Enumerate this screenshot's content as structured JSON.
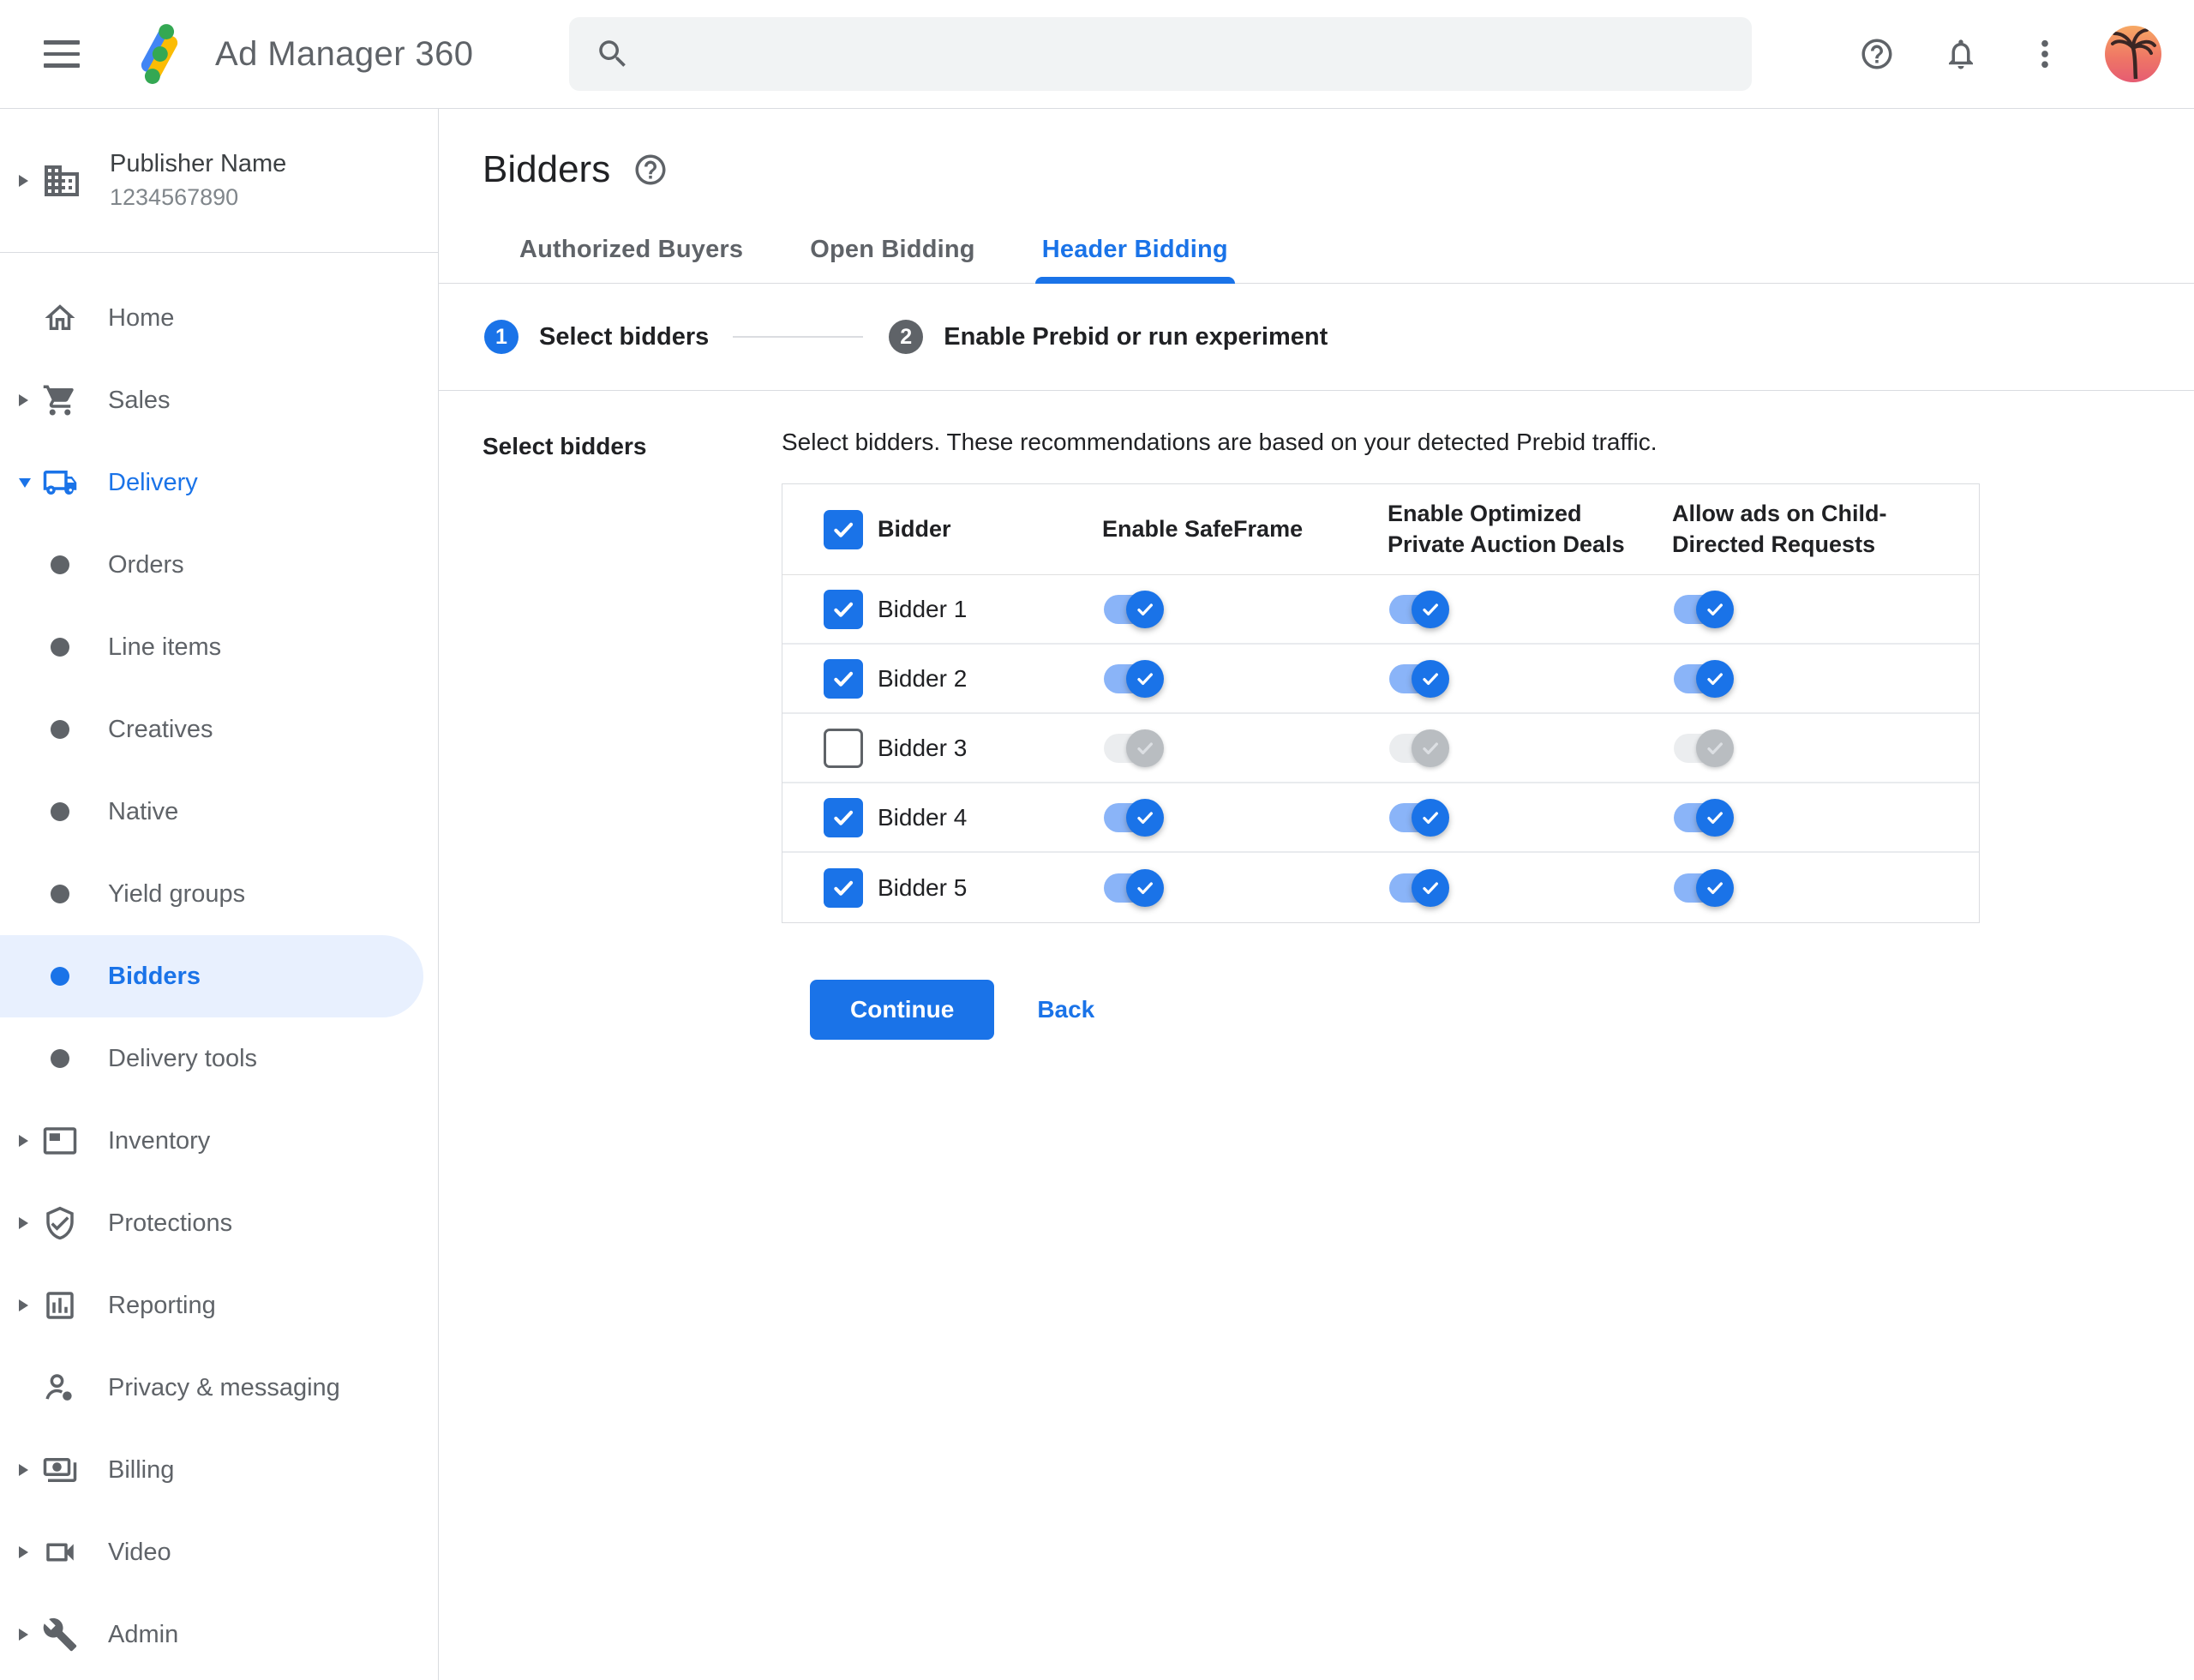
{
  "topbar": {
    "app_name": "Ad Manager 360",
    "search": {
      "value": "",
      "placeholder": ""
    },
    "icons": [
      "menu-icon",
      "ad-manager-logo",
      "search-icon",
      "help-icon",
      "notifications-icon",
      "more-options-icon",
      "account-avatar"
    ]
  },
  "sidebar": {
    "publisher": {
      "name": "Publisher Name",
      "account_id": "1234567890"
    },
    "items": [
      {
        "label": "Home",
        "level": "root",
        "expandable": false,
        "selected": false
      },
      {
        "label": "Sales",
        "level": "root",
        "expandable": true,
        "selected": false
      },
      {
        "label": "Delivery",
        "level": "root",
        "expandable": true,
        "expanded": true,
        "selected": false
      },
      {
        "label": "Orders",
        "level": "sub",
        "selected": false
      },
      {
        "label": "Line items",
        "level": "sub",
        "selected": false
      },
      {
        "label": "Creatives",
        "level": "sub",
        "selected": false
      },
      {
        "label": "Native",
        "level": "sub",
        "selected": false
      },
      {
        "label": "Yield groups",
        "level": "sub",
        "selected": false
      },
      {
        "label": "Bidders",
        "level": "sub",
        "selected": true
      },
      {
        "label": "Delivery tools",
        "level": "sub",
        "selected": false
      },
      {
        "label": "Inventory",
        "level": "root",
        "expandable": true,
        "selected": false
      },
      {
        "label": "Protections",
        "level": "root",
        "expandable": true,
        "selected": false
      },
      {
        "label": "Reporting",
        "level": "root",
        "expandable": true,
        "selected": false
      },
      {
        "label": "Privacy & messaging",
        "level": "root",
        "expandable": false,
        "selected": false
      },
      {
        "label": "Billing",
        "level": "root",
        "expandable": true,
        "selected": false
      },
      {
        "label": "Video",
        "level": "root",
        "expandable": true,
        "selected": false
      },
      {
        "label": "Admin",
        "level": "root",
        "expandable": true,
        "selected": false
      }
    ]
  },
  "main": {
    "page_title": "Bidders",
    "tabs": [
      {
        "label": "Authorized Buyers",
        "active": false
      },
      {
        "label": "Open Bidding",
        "active": false
      },
      {
        "label": "Header Bidding",
        "active": true
      }
    ],
    "stepper": [
      {
        "number": "1",
        "label": "Select bidders",
        "active": true
      },
      {
        "number": "2",
        "label": "Enable Prebid or run experiment",
        "active": false
      }
    ],
    "section_label": "Select bidders",
    "description": "Select bidders. These recommendations are based on your detected Prebid traffic.",
    "table": {
      "select_all_checked": true,
      "headers": [
        "Bidder",
        "Enable SafeFrame",
        "Enable Optimized Private Auction Deals",
        "Allow ads on Child-Directed Requests"
      ],
      "rows": [
        {
          "name": "Bidder 1",
          "selected": true,
          "enable_safeframe": true,
          "enable_optimized_private_auction_deals": true,
          "allow_ads_child_directed": true
        },
        {
          "name": "Bidder 2",
          "selected": true,
          "enable_safeframe": true,
          "enable_optimized_private_auction_deals": true,
          "allow_ads_child_directed": true
        },
        {
          "name": "Bidder 3",
          "selected": false,
          "enable_safeframe": false,
          "enable_optimized_private_auction_deals": false,
          "allow_ads_child_directed": false
        },
        {
          "name": "Bidder 4",
          "selected": true,
          "enable_safeframe": true,
          "enable_optimized_private_auction_deals": true,
          "allow_ads_child_directed": true
        },
        {
          "name": "Bidder 5",
          "selected": true,
          "enable_safeframe": true,
          "enable_optimized_private_auction_deals": true,
          "allow_ads_child_directed": true
        }
      ]
    },
    "actions": {
      "continue": "Continue",
      "back": "Back"
    }
  },
  "colors": {
    "accent_blue": "#1a73e8",
    "toggle_track_on": "#8ab4f8",
    "toggle_track_off": "#ebedef",
    "toggle_thumb_off": "#b9bdc1",
    "selected_item_bg": "#e8f0fe",
    "text_primary": "#202124",
    "text_secondary": "#5f6368",
    "divider": "#dadce0",
    "search_bg": "#f1f3f4",
    "step_inactive": "#5f6368",
    "logo_blue": "#4285f4",
    "logo_yellow": "#fbbc04",
    "logo_green": "#34a853"
  }
}
